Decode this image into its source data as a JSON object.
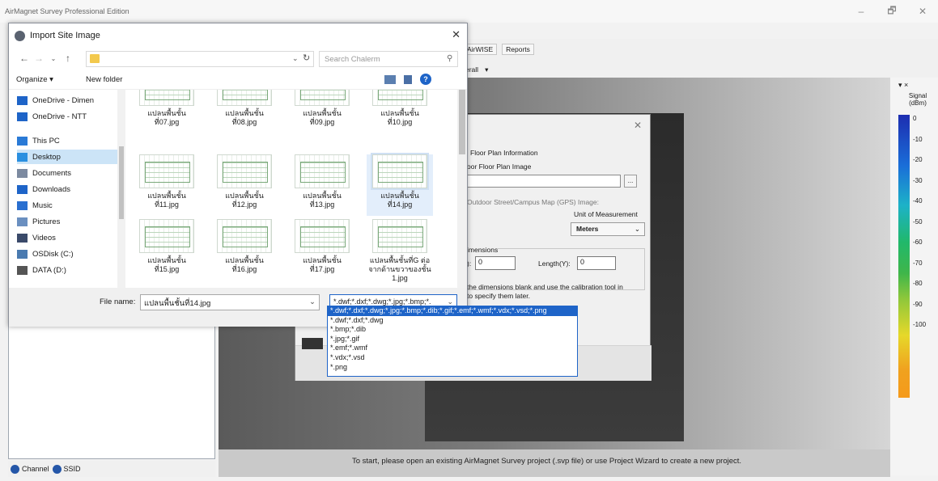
{
  "app": {
    "title": "AirMagnet Survey Professional Edition",
    "window_controls": [
      "–",
      "🗗",
      "✕"
    ]
  },
  "toolbar": {
    "airwise": "AirWISE",
    "reports": "Reports",
    "overall": "erall"
  },
  "legend": {
    "header": "▾ ×",
    "title": "Signal (dBm)",
    "ticks": [
      "0",
      "-10",
      "-20",
      "-30",
      "-40",
      "-50",
      "-60",
      "-70",
      "-80",
      "-90",
      "-100"
    ],
    "colors": [
      "#1d2db0",
      "#1a6ed8",
      "#1db2c8",
      "#21b86b",
      "#3fb64a",
      "#8ec73b",
      "#e6d82a",
      "#f0a21f",
      "#f59a1b"
    ]
  },
  "status_message": "To start, please open an existing AirMagnet Survey project (.svp file) or use Project Wizard to create a new project.",
  "left_tabs": [
    {
      "label": "Channel"
    },
    {
      "label": "SSID"
    }
  ],
  "floor_dialog": {
    "section_title": "Floor Plan Information",
    "image_label": "oor Floor Plan Image",
    "outdoor_label": "Outdoor Street/Campus Map (GPS) Image:",
    "unit_label": "Unit of Measurement",
    "unit_value": "Meters",
    "dimensions_label": "imensions",
    "width_label": "):",
    "width_value": "0",
    "length_label": "Length(Y):",
    "length_value": "0",
    "note_line1": "the dimensions blank and use the calibration tool in",
    "note_line2": "to specify them later.",
    "browse_label": "..."
  },
  "import_dialog": {
    "title": "Import Site Image",
    "search_placeholder": "Search Chalerm",
    "organize": "Organize ▾",
    "new_folder": "New folder",
    "nav_items": [
      {
        "label": "OneDrive - Dimen",
        "icon": "onedrive-icon"
      },
      {
        "label": "OneDrive - NTT",
        "icon": "onedrive-icon"
      },
      {
        "label": "This PC",
        "icon": "pc-icon"
      },
      {
        "label": "Desktop",
        "icon": "desktop-icon",
        "selected": true
      },
      {
        "label": "Documents",
        "icon": "documents-icon"
      },
      {
        "label": "Downloads",
        "icon": "downloads-icon"
      },
      {
        "label": "Music",
        "icon": "music-icon"
      },
      {
        "label": "Pictures",
        "icon": "pictures-icon"
      },
      {
        "label": "Videos",
        "icon": "videos-icon"
      },
      {
        "label": "OSDisk (C:)",
        "icon": "disk-icon"
      },
      {
        "label": "DATA (D:)",
        "icon": "drive-icon"
      }
    ],
    "files": [
      {
        "line1": "แปลนพื้นชั้น",
        "line2": "ที่07.jpg"
      },
      {
        "line1": "แปลนพื้นชั้น",
        "line2": "ที่08.jpg"
      },
      {
        "line1": "แปลนพื้นชั้น",
        "line2": "ที่09.jpg"
      },
      {
        "line1": "แปลนพื้นชั้น",
        "line2": "ที่10.jpg"
      },
      {
        "line1": "แปลนพื้นชั้น",
        "line2": "ที่11.jpg"
      },
      {
        "line1": "แปลนพื้นชั้น",
        "line2": "ที่12.jpg"
      },
      {
        "line1": "แปลนพื้นชั้น",
        "line2": "ที่13.jpg"
      },
      {
        "line1": "แปลนพื้นชั้น",
        "line2": "ที่14.jpg",
        "selected": true
      },
      {
        "line1": "แปลนพื้นชั้น",
        "line2": "ที่15.jpg"
      },
      {
        "line1": "แปลนพื้นชั้น",
        "line2": "ที่16.jpg"
      },
      {
        "line1": "แปลนพื้นชั้น",
        "line2": "ที่17.jpg"
      },
      {
        "line1": "แปลนพื้นชั้นที่G ต่อ",
        "line2": "จากด้านขวาของชั้น",
        "line3": "1.jpg"
      }
    ],
    "file_name_label": "File name:",
    "file_name_value": "แปลนพื้นชั้นที่14.jpg",
    "file_type_value": "*.dwf;*.dxf;*.dwg;*.jpg;*.bmp;*.",
    "file_type_options": [
      "*.dwf;*.dxf;*.dwg;*.jpg;*.bmp;*.dib;*.gif;*.emf;*.wmf;*.vdx;*.vsd;*.png",
      "*.dwf;*.dxf;*.dwg",
      "*.bmp;*.dib",
      "*.jpg;*.gif",
      "*.emf;*.wmf",
      "*.vdx;*.vsd",
      "*.png"
    ]
  }
}
